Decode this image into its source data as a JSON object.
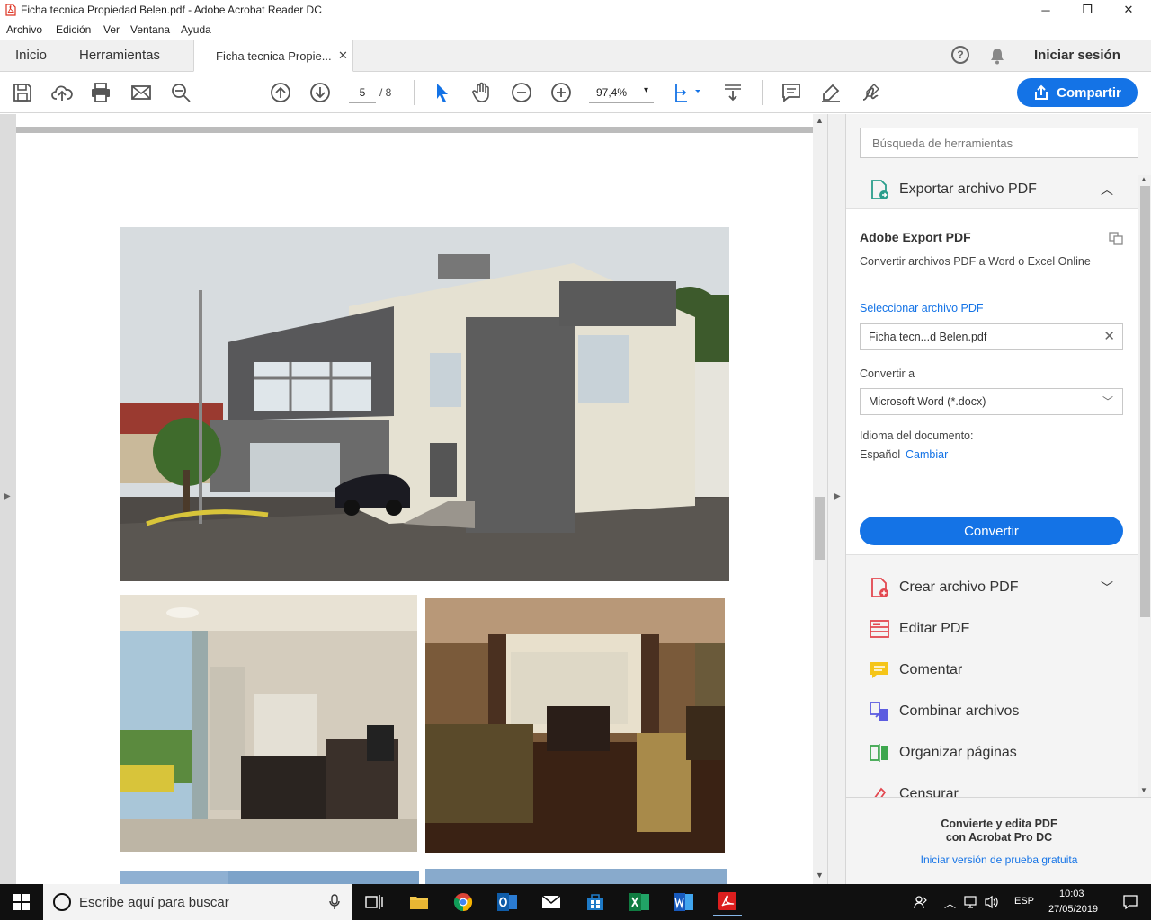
{
  "window": {
    "title": "Ficha tecnica Propiedad Belen.pdf - Adobe Acrobat Reader DC",
    "minimize": "─",
    "maximize": "❐",
    "close": "✕"
  },
  "menu": [
    "Archivo",
    "Edición",
    "Ver",
    "Ventana",
    "Ayuda"
  ],
  "tabs": {
    "home": "Inicio",
    "tools": "Herramientas",
    "document": "Ficha tecnica Propie...",
    "document_close": "✕",
    "help": "?",
    "signin": "Iniciar sesión"
  },
  "toolbar": {
    "page_current": "5",
    "page_total": "/ 8",
    "zoom": "97,4%",
    "share_label": "Compartir",
    "icons": [
      "save-icon",
      "upload-icon",
      "print-icon",
      "email-icon",
      "search-zoom-icon",
      "page-up-icon",
      "page-down-icon",
      "select-icon",
      "hand-icon",
      "zoom-out-icon",
      "zoom-in-icon",
      "fit-page-icon",
      "scroll-mode-icon",
      "comment-icon",
      "highlight-icon",
      "sign-icon"
    ]
  },
  "pane": {
    "search_placeholder": "Búsqueda de herramientas",
    "export": {
      "header": "Exportar archivo PDF",
      "title": "Adobe Export PDF",
      "subtitle": "Convertir archivos PDF a Word o Excel Online",
      "select_file": "Seleccionar archivo PDF",
      "file_name": "Ficha tecn...d Belen.pdf",
      "convert_to": "Convertir a",
      "format": "Microsoft Word (*.docx)",
      "doc_lang_label": "Idioma del documento:",
      "doc_lang": "Español",
      "change": "Cambiar",
      "convert_button": "Convertir"
    },
    "tools": [
      {
        "label": "Crear archivo PDF",
        "icon": "create-pdf-icon",
        "color": "#e34850"
      },
      {
        "label": "Editar PDF",
        "icon": "edit-pdf-icon",
        "color": "#e34850"
      },
      {
        "label": "Comentar",
        "icon": "comment-tool-icon",
        "color": "#f5c518"
      },
      {
        "label": "Combinar archivos",
        "icon": "combine-icon",
        "color": "#5c5ce0"
      },
      {
        "label": "Organizar páginas",
        "icon": "organize-icon",
        "color": "#3da74e"
      },
      {
        "label": "Censurar",
        "icon": "redact-icon",
        "color": "#e34850"
      }
    ],
    "promo": {
      "line1": "Convierte y edita PDF",
      "line2": "con Acrobat Pro DC",
      "trial": "Iniciar versión de prueba gratuita"
    }
  },
  "taskbar": {
    "search_placeholder": "Escribe aquí para buscar",
    "lang": "ESP",
    "time": "10:03",
    "date": "27/05/2019"
  },
  "colors": {
    "accent": "#1473e6",
    "taskbar": "#101010"
  }
}
